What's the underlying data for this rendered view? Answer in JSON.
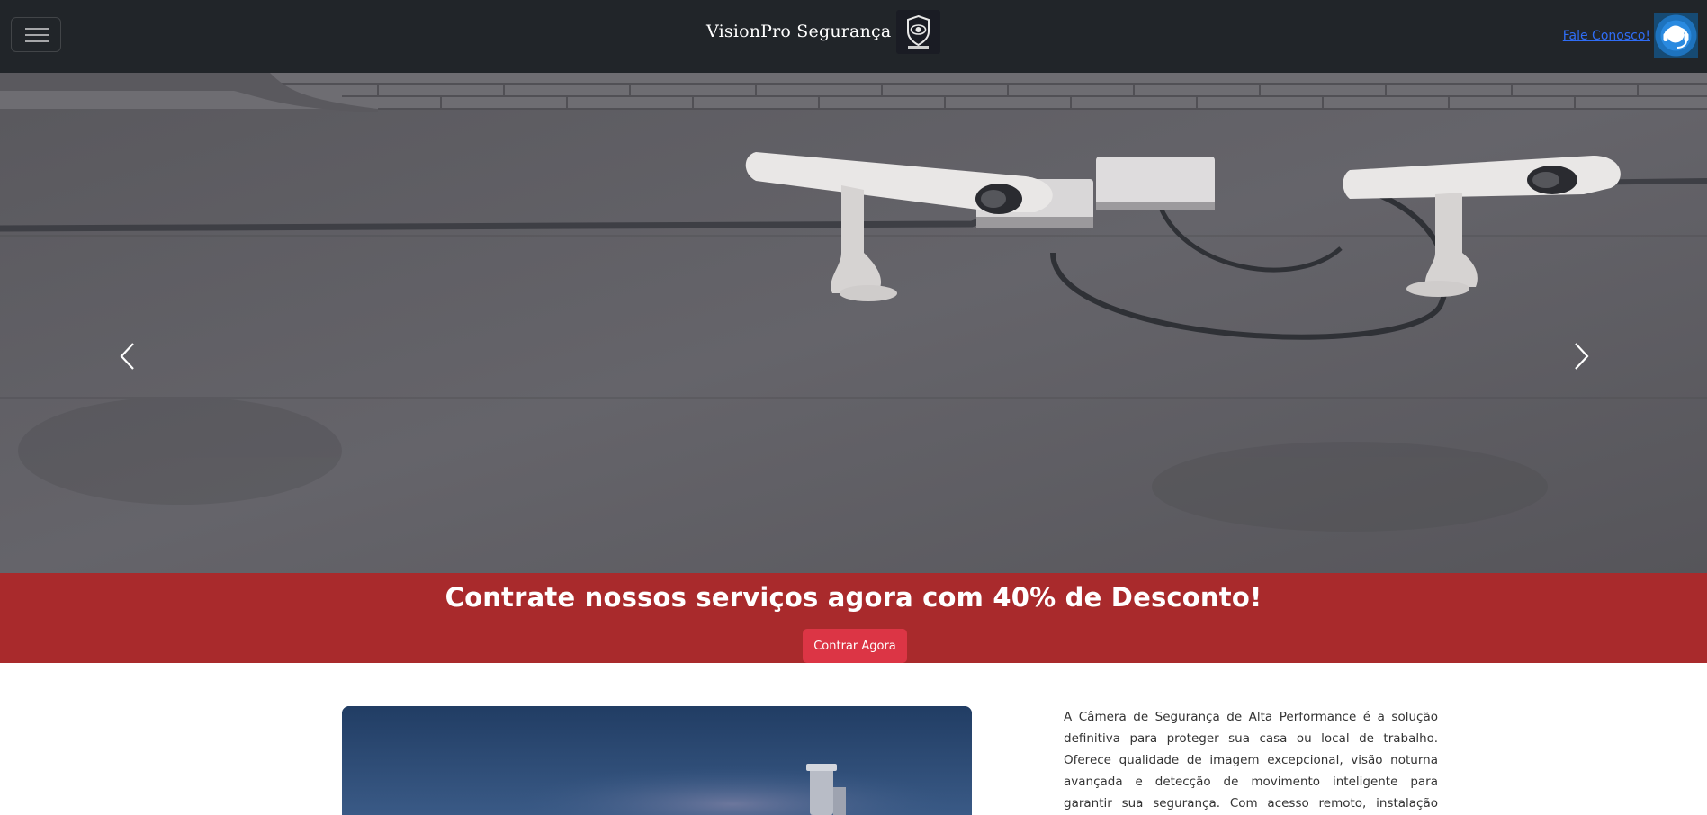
{
  "navbar": {
    "toggle_icon": "hamburger-menu-icon",
    "brand_name": "VisionPro Segurança",
    "brand_logo_icon": "eye-shield-logo-icon",
    "contact_label": "Fale Conosco!",
    "contact_icon": "headset-support-icon",
    "link_color": "#2f6df5"
  },
  "hero": {
    "prev_icon": "chevron-left-icon",
    "next_icon": "chevron-right-icon"
  },
  "promo": {
    "title": "Contrate nossos serviços agora com 40% de Desconto!",
    "button_label": "Contrar Agora",
    "band_color": "#a92a2c",
    "button_color": "#dc3545"
  },
  "product": {
    "description": "A Câmera de Segurança de Alta Performance é a solução definitiva para proteger sua casa ou local de trabalho. Oferece qualidade de imagem excepcional, visão noturna avançada e detecção de movimento inteligente para garantir sua segurança. Com acesso remoto, instalação simples e"
  }
}
